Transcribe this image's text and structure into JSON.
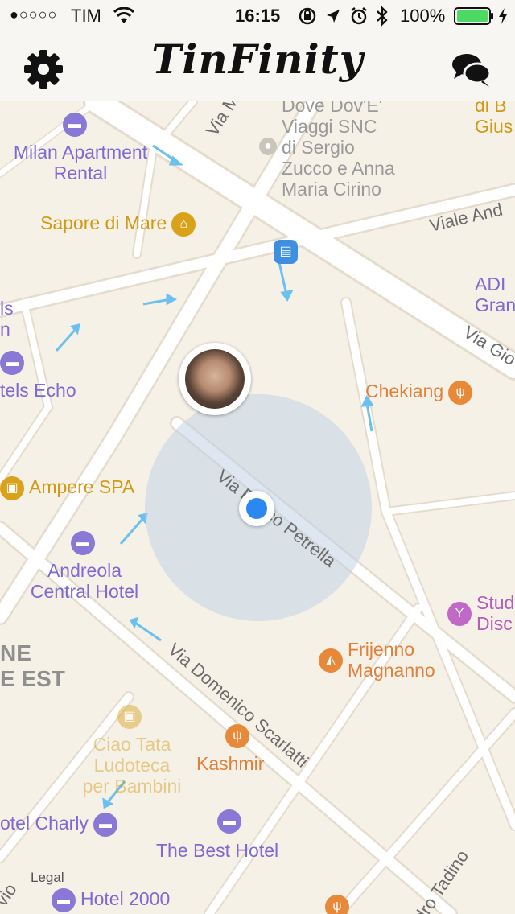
{
  "status_bar": {
    "signal": "●○○○○",
    "carrier": "TIM",
    "time": "16:15",
    "battery_percent": "100%",
    "icons": [
      "wifi-icon",
      "rotation-lock-icon",
      "location-arrow-icon",
      "alarm-icon",
      "bluetooth-icon",
      "battery-icon",
      "charging-icon"
    ]
  },
  "nav": {
    "title": "TinFinity",
    "left_icon": "gear-icon",
    "right_icon": "chat-bubbles-icon"
  },
  "map": {
    "pois": [
      {
        "label": "Milan Apartment\nRental",
        "type": "hotel"
      },
      {
        "label": "Sapore di Mare",
        "type": "shop"
      },
      {
        "label": "Dove Dov'E'\nViaggi SNC\ndi Sergio\nZucco e Anna\nMaria Cirino",
        "type": "generic"
      },
      {
        "label": "ADI\nGran",
        "type": "hotel"
      },
      {
        "label": "tels Echo",
        "type": "hotel"
      },
      {
        "label": "Chekiang",
        "type": "restaurant"
      },
      {
        "label": "Ampere SPA",
        "type": "shop"
      },
      {
        "label": "Andreola\nCentral Hotel",
        "type": "hotel"
      },
      {
        "label": "Stud\nDisc",
        "type": "bar"
      },
      {
        "label": "Frijenno\nMagnanno",
        "type": "pizza"
      },
      {
        "label": "Ciao Tata\nLudoteca\nper Bambini",
        "type": "shop"
      },
      {
        "label": "Kashmir",
        "type": "restaurant"
      },
      {
        "label": "otel Charly",
        "type": "hotel"
      },
      {
        "label": "The Best Hotel",
        "type": "hotel"
      },
      {
        "label": "Hotel 2000",
        "type": "hotel"
      },
      {
        "label": "di B\nGius",
        "type": "shop"
      }
    ],
    "streets": [
      "Via M",
      "Viale And",
      "Via Gio",
      "Via Enrico Petrella",
      "Via Domenico Scarlatti",
      "dro Tadino",
      "vio"
    ],
    "district": "NE\nE EST",
    "partial_labels": [
      "ls\nn"
    ],
    "legal": "Legal"
  },
  "colors": {
    "hotel": "#8a78d6",
    "shop": "#d9a21a",
    "restaurant": "#e8893a",
    "bar": "#c069c6",
    "map_bg": "#f6f1e7",
    "road": "#ffffff",
    "user_dot": "#2b88f0"
  }
}
